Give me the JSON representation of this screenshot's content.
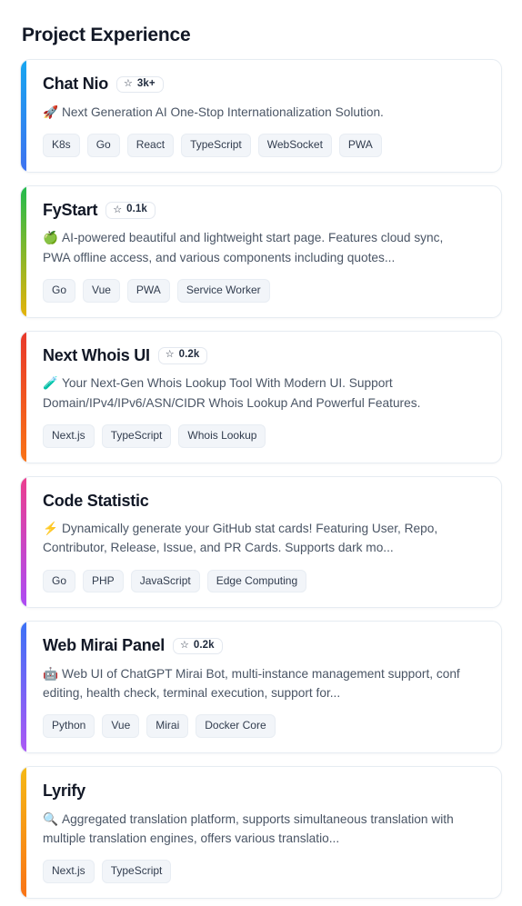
{
  "page": {
    "title": "Project Experience"
  },
  "star_icon": "☆",
  "projects": [
    {
      "name": "Chat Nio",
      "stars": "3k+",
      "has_stars": true,
      "emoji": "🚀",
      "emoji_name": "rocket-emoji",
      "description": "Next Generation AI One-Stop Internationalization Solution.",
      "accent_from": "#17a6f0",
      "accent_to": "#3e72f0",
      "tags": [
        "K8s",
        "Go",
        "React",
        "TypeScript",
        "WebSocket",
        "PWA"
      ]
    },
    {
      "name": "FyStart",
      "stars": "0.1k",
      "has_stars": true,
      "emoji": "🍏",
      "emoji_name": "green-apple-emoji",
      "description": "AI-powered beautiful and lightweight start page. Features cloud sync, PWA offline access, and various components including quotes...",
      "accent_from": "#21bb4e",
      "accent_to": "#e6b30a",
      "tags": [
        "Go",
        "Vue",
        "PWA",
        "Service Worker"
      ]
    },
    {
      "name": "Next Whois UI",
      "stars": "0.2k",
      "has_stars": true,
      "emoji": "🧪",
      "emoji_name": "test-tube-emoji",
      "description": "Your Next-Gen Whois Lookup Tool With Modern UI. Support Domain/IPv4/IPv6/ASN/CIDR Whois Lookup And Powerful Features.",
      "accent_from": "#e8392c",
      "accent_to": "#f97316",
      "tags": [
        "Next.js",
        "TypeScript",
        "Whois Lookup"
      ]
    },
    {
      "name": "Code Statistic",
      "stars": "",
      "has_stars": false,
      "emoji": "⚡",
      "emoji_name": "high-voltage-emoji",
      "description": "Dynamically generate your GitHub stat cards! Featuring User, Repo, Contributor, Release, Issue, and PR Cards. Supports dark mo...",
      "accent_from": "#ec3f8e",
      "accent_to": "#ac4cf5",
      "tags": [
        "Go",
        "PHP",
        "JavaScript",
        "Edge Computing"
      ]
    },
    {
      "name": "Web Mirai Panel",
      "stars": "0.2k",
      "has_stars": true,
      "emoji": "🤖",
      "emoji_name": "robot-emoji",
      "description": "Web UI of ChatGPT Mirai Bot, multi-instance management support, conf editing, health check, terminal execution, support for...",
      "accent_from": "#3b72f6",
      "accent_to": "#ac58f5",
      "tags": [
        "Python",
        "Vue",
        "Mirai",
        "Docker Core"
      ]
    },
    {
      "name": "Lyrify",
      "stars": "",
      "has_stars": false,
      "emoji": "🔍",
      "emoji_name": "magnifying-glass-emoji",
      "description": "Aggregated translation platform, supports simultaneous translation with multiple translation engines, offers various translatio...",
      "accent_from": "#f5b916",
      "accent_to": "#f97316",
      "tags": [
        "Next.js",
        "TypeScript"
      ]
    }
  ]
}
